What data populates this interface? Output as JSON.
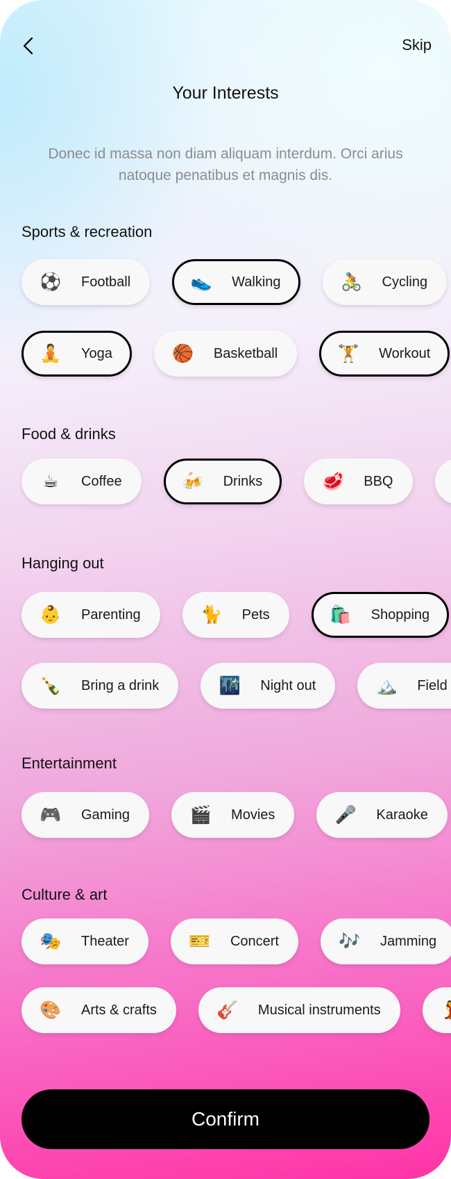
{
  "header": {
    "back_icon": "chevron-left-icon",
    "skip_label": "Skip",
    "title": "Your Interests",
    "description": "Donec id massa non diam aliquam interdum. Orci arius natoque penatibus et magnis dis."
  },
  "sections": [
    {
      "title": "Sports & recreation",
      "rows": [
        [
          {
            "emoji": "⚽",
            "label": "Football",
            "selected": false
          },
          {
            "emoji": "👟",
            "label": "Walking",
            "selected": true
          },
          {
            "emoji": "🚴",
            "label": "Cycling",
            "selected": false
          }
        ],
        [
          {
            "emoji": "🧘",
            "label": "Yoga",
            "selected": true
          },
          {
            "emoji": "🏀",
            "label": "Basketball",
            "selected": false
          },
          {
            "emoji": "🏋️",
            "label": "Workout",
            "selected": true
          }
        ]
      ]
    },
    {
      "title": "Food & drinks",
      "rows": [
        [
          {
            "emoji": "☕",
            "label": "Coffee",
            "selected": false
          },
          {
            "emoji": "🍻",
            "label": "Drinks",
            "selected": true
          },
          {
            "emoji": "🥩",
            "label": "BBQ",
            "selected": false
          },
          {
            "emoji": "🥙",
            "label": "",
            "selected": false
          }
        ]
      ]
    },
    {
      "title": "Hanging out",
      "rows": [
        [
          {
            "emoji": "👶",
            "label": "Parenting",
            "selected": false
          },
          {
            "emoji": "🐈",
            "label": "Pets",
            "selected": false
          },
          {
            "emoji": "🛍️",
            "label": "Shopping",
            "selected": true
          }
        ],
        [
          {
            "emoji": "🍾",
            "label": "Bring a drink",
            "selected": false
          },
          {
            "emoji": "🌃",
            "label": "Night out",
            "selected": false
          },
          {
            "emoji": "🏔️",
            "label": "Field tri",
            "selected": false
          }
        ]
      ]
    },
    {
      "title": "Entertainment",
      "rows": [
        [
          {
            "emoji": "🎮",
            "label": "Gaming",
            "selected": false
          },
          {
            "emoji": "🎬",
            "label": "Movies",
            "selected": false
          },
          {
            "emoji": "🎤",
            "label": "Karaoke",
            "selected": false
          }
        ]
      ]
    },
    {
      "title": "Culture & art",
      "rows": [
        [
          {
            "emoji": "🎭",
            "label": "Theater",
            "selected": false
          },
          {
            "emoji": "🎫",
            "label": "Concert",
            "selected": false
          },
          {
            "emoji": "🎶",
            "label": "Jamming",
            "selected": false
          }
        ],
        [
          {
            "emoji": "🎨",
            "label": "Arts & crafts",
            "selected": false
          },
          {
            "emoji": "🎸",
            "label": "Musical instruments",
            "selected": false
          },
          {
            "emoji": "💃",
            "label": "",
            "selected": false
          }
        ]
      ]
    }
  ],
  "confirm_label": "Confirm",
  "colors": {
    "selected_border": "#000000",
    "chip_bg": "#f8f8f8",
    "button_bg": "#000000",
    "gradient_top": "#c9f0fb",
    "gradient_bottom": "#ff33a6"
  }
}
